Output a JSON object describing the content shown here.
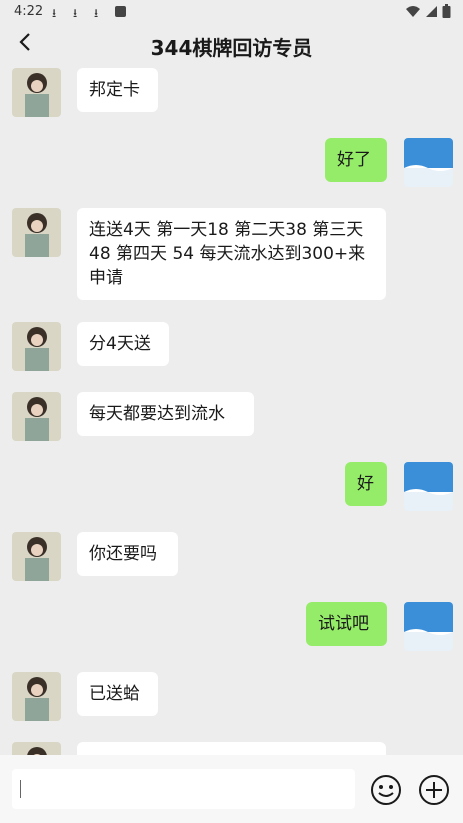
{
  "status_bar": {
    "time": "4:22",
    "download_icons": [
      "download-icon",
      "download-icon",
      "download-icon"
    ],
    "app_icon": "app-notification-icon",
    "right_icons": [
      "wifi-icon",
      "signal-icon",
      "battery-icon"
    ]
  },
  "header": {
    "title": "344棋牌回访专员",
    "back_icon": "chevron-left-icon"
  },
  "messages": [
    {
      "side": "left",
      "text": "邦定卡"
    },
    {
      "side": "right",
      "text": "好了"
    },
    {
      "side": "left",
      "text": "连送4天 第一天18 第二天38 第三天 48 第四天 54 每天流水达到300+来申请"
    },
    {
      "side": "left",
      "text": "分4天送"
    },
    {
      "side": "left",
      "text": "每天都要达到流水"
    },
    {
      "side": "right",
      "text": "好"
    },
    {
      "side": "left",
      "text": "你还要吗"
    },
    {
      "side": "right",
      "text": "试试吧"
    },
    {
      "side": "left",
      "text": "已送蛤"
    },
    {
      "side": "left",
      "text": ""
    }
  ],
  "input": {
    "value": "",
    "placeholder": ""
  },
  "icons": {
    "emoji": "emoji-icon",
    "plus": "plus-circle-icon"
  },
  "colors": {
    "background": "#ededed",
    "bubble_left": "#ffffff",
    "bubble_right": "#95ec69"
  }
}
